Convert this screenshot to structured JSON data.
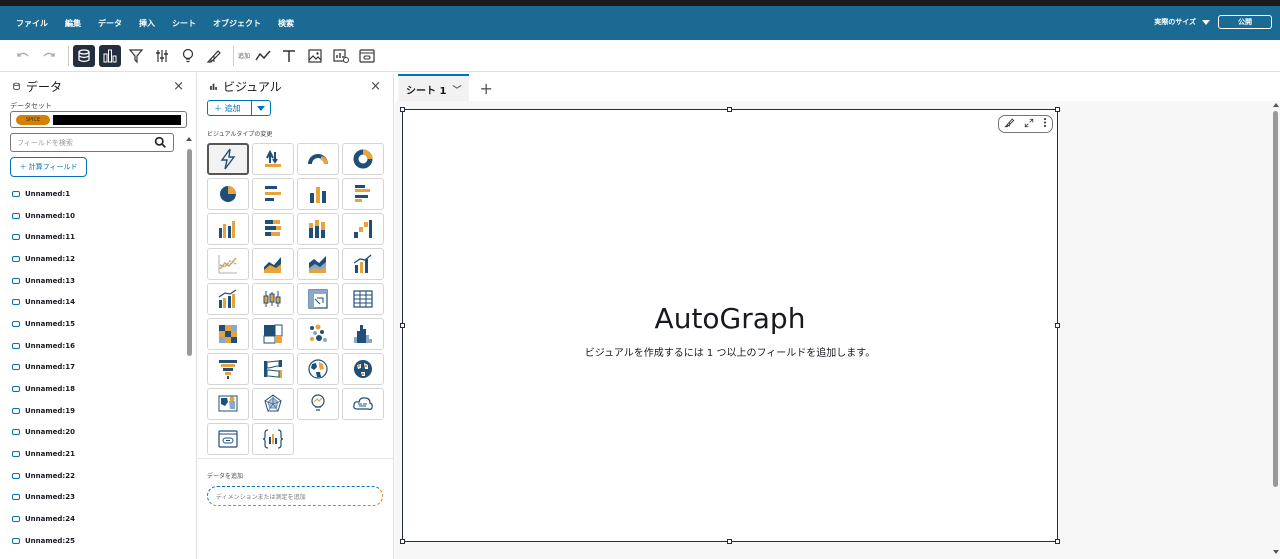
{
  "menu": {
    "items": [
      "ファイル",
      "編集",
      "データ",
      "挿入",
      "シート",
      "オブジェクト",
      "検索"
    ],
    "size_label": "実際のサイズ",
    "publish_label": "公開"
  },
  "toolbar": {
    "add_label": "追加"
  },
  "data_panel": {
    "title": "データ",
    "close": "×",
    "dataset_label": "データセット",
    "spice_badge": "SPICE",
    "search_placeholder": "フィールドを検索",
    "calc_field_label": "＋ 計算フィールド",
    "fields": [
      "Unnamed:1",
      "Unnamed:10",
      "Unnamed:11",
      "Unnamed:12",
      "Unnamed:13",
      "Unnamed:14",
      "Unnamed:15",
      "Unnamed:16",
      "Unnamed:17",
      "Unnamed:18",
      "Unnamed:19",
      "Unnamed:20",
      "Unnamed:21",
      "Unnamed:22",
      "Unnamed:23",
      "Unnamed:24",
      "Unnamed:25"
    ]
  },
  "visual_panel": {
    "title": "ビジュアル",
    "close": "×",
    "add_label": "＋ 追加",
    "visual_types_label": "ビジュアルタイプの変更",
    "add_data_label": "データを追加",
    "drop_zone_text": "ディメンションまたは測定を追加",
    "visual_types": [
      "autograph-icon",
      "kpi-icon",
      "gauge-icon",
      "donut-icon",
      "pie-icon",
      "horizontal-bar-icon",
      "vertical-bar-icon",
      "clustered-horizontal-bar-icon",
      "clustered-vertical-bar-icon",
      "stacked-horizontal-bar-icon",
      "stacked-vertical-bar-icon",
      "waterfall-icon",
      "line-icon",
      "area-icon",
      "stacked-area-icon",
      "combo-bar-line-icon",
      "combo-clustered-icon",
      "box-plot-icon",
      "pivot-table-icon",
      "table-icon",
      "heatmap-icon",
      "treemap-icon",
      "scatter-icon",
      "histogram-icon",
      "funnel-icon",
      "sankey-icon",
      "filled-map-icon",
      "point-map-icon",
      "geo-map-icon",
      "radar-icon",
      "insight-icon",
      "word-cloud-icon",
      "custom-visual-icon",
      "narrative-icon"
    ]
  },
  "sheet": {
    "tab_label": "シート 1",
    "visual_title": "AutoGraph",
    "visual_message": "ビジュアルを作成するには 1 つ以上のフィールドを追加します。"
  },
  "colors": {
    "menubar": "#1b6a94",
    "accent": "#0073bb",
    "orange": "#d68000",
    "navy": "#232f3e"
  }
}
